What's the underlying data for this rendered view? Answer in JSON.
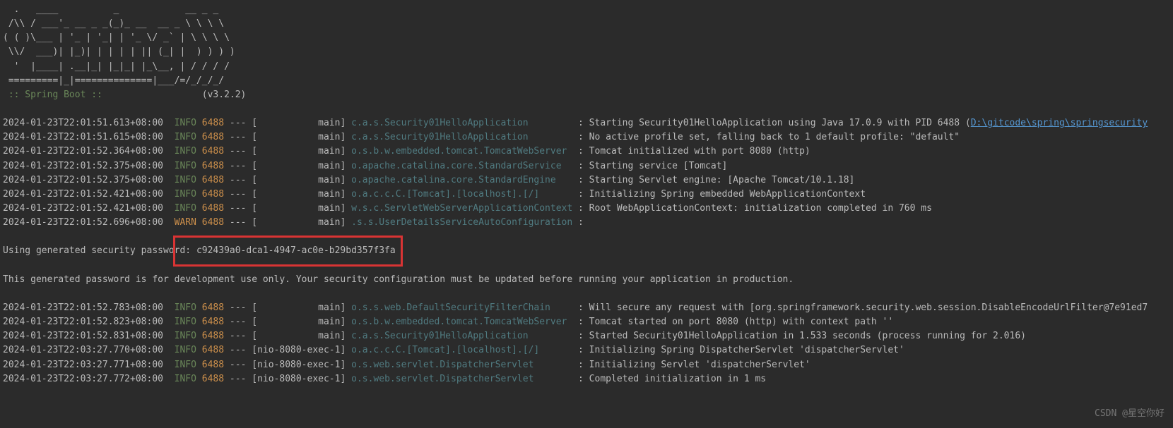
{
  "ascii": [
    "  .   ____          _            __ _ _",
    " /\\\\ / ___'_ __ _ _(_)_ __  __ _ \\ \\ \\ \\",
    "( ( )\\___ | '_ | '_| | '_ \\/ _` | \\ \\ \\ \\",
    " \\\\/  ___)| |_)| | | | | || (_| |  ) ) ) )",
    "  '  |____| .__|_| |_|_| |_\\__, | / / / /",
    " =========|_|==============|___/=/_/_/_/"
  ],
  "banner": {
    "label": " :: Spring Boot ::",
    "version": "(v3.2.2)"
  },
  "logs1": [
    {
      "ts": "2024-01-23T22:01:51.613+08:00",
      "lvl": "INFO",
      "pid": "6488",
      "sep": "--- [",
      "thread": "main",
      "br": "] ",
      "logger": "c.a.s.Security01HelloApplication",
      "msg": ": Starting Security01HelloApplication using Java 17.0.9 with PID 6488 (",
      "link": "D:\\gitcode\\spring\\springsecurity"
    },
    {
      "ts": "2024-01-23T22:01:51.615+08:00",
      "lvl": "INFO",
      "pid": "6488",
      "sep": "--- [",
      "thread": "main",
      "br": "] ",
      "logger": "c.a.s.Security01HelloApplication",
      "msg": ": No active profile set, falling back to 1 default profile: \"default\""
    },
    {
      "ts": "2024-01-23T22:01:52.364+08:00",
      "lvl": "INFO",
      "pid": "6488",
      "sep": "--- [",
      "thread": "main",
      "br": "] ",
      "logger": "o.s.b.w.embedded.tomcat.TomcatWebServer",
      "msg": ": Tomcat initialized with port 8080 (http)"
    },
    {
      "ts": "2024-01-23T22:01:52.375+08:00",
      "lvl": "INFO",
      "pid": "6488",
      "sep": "--- [",
      "thread": "main",
      "br": "] ",
      "logger": "o.apache.catalina.core.StandardService",
      "msg": ": Starting service [Tomcat]"
    },
    {
      "ts": "2024-01-23T22:01:52.375+08:00",
      "lvl": "INFO",
      "pid": "6488",
      "sep": "--- [",
      "thread": "main",
      "br": "] ",
      "logger": "o.apache.catalina.core.StandardEngine",
      "msg": ": Starting Servlet engine: [Apache Tomcat/10.1.18]"
    },
    {
      "ts": "2024-01-23T22:01:52.421+08:00",
      "lvl": "INFO",
      "pid": "6488",
      "sep": "--- [",
      "thread": "main",
      "br": "] ",
      "logger": "o.a.c.c.C.[Tomcat].[localhost].[/]",
      "msg": ": Initializing Spring embedded WebApplicationContext"
    },
    {
      "ts": "2024-01-23T22:01:52.421+08:00",
      "lvl": "INFO",
      "pid": "6488",
      "sep": "--- [",
      "thread": "main",
      "br": "] ",
      "logger": "w.s.c.ServletWebServerApplicationContext",
      "msg": ": Root WebApplicationContext: initialization completed in 760 ms"
    },
    {
      "ts": "2024-01-23T22:01:52.696+08:00",
      "lvl": "WARN",
      "pid": "6488",
      "sep": "--- [",
      "thread": "main",
      "br": "] ",
      "logger": ".s.s.UserDetailsServiceAutoConfiguration",
      "msg": ": "
    }
  ],
  "password": {
    "label": "Using generated security password: ",
    "value": "c92439a0-dca1-4947-ac0e-b29bd357f3fa"
  },
  "note": "This generated password is for development use only. Your security configuration must be updated before running your application in production.",
  "logs2": [
    {
      "ts": "2024-01-23T22:01:52.783+08:00",
      "lvl": "INFO",
      "pid": "6488",
      "sep": "--- [",
      "thread": "main",
      "br": "] ",
      "logger": "o.s.s.web.DefaultSecurityFilterChain",
      "msg": ": Will secure any request with [org.springframework.security.web.session.DisableEncodeUrlFilter@7e91ed7"
    },
    {
      "ts": "2024-01-23T22:01:52.823+08:00",
      "lvl": "INFO",
      "pid": "6488",
      "sep": "--- [",
      "thread": "main",
      "br": "] ",
      "logger": "o.s.b.w.embedded.tomcat.TomcatWebServer",
      "msg": ": Tomcat started on port 8080 (http) with context path ''"
    },
    {
      "ts": "2024-01-23T22:01:52.831+08:00",
      "lvl": "INFO",
      "pid": "6488",
      "sep": "--- [",
      "thread": "main",
      "br": "] ",
      "logger": "c.a.s.Security01HelloApplication",
      "msg": ": Started Security01HelloApplication in 1.533 seconds (process running for 2.016)"
    },
    {
      "ts": "2024-01-23T22:03:27.770+08:00",
      "lvl": "INFO",
      "pid": "6488",
      "sep": "--- [",
      "thread": "nio-8080-exec-1",
      "br": "] ",
      "logger": "o.a.c.c.C.[Tomcat].[localhost].[/]",
      "msg": ": Initializing Spring DispatcherServlet 'dispatcherServlet'"
    },
    {
      "ts": "2024-01-23T22:03:27.771+08:00",
      "lvl": "INFO",
      "pid": "6488",
      "sep": "--- [",
      "thread": "nio-8080-exec-1",
      "br": "] ",
      "logger": "o.s.web.servlet.DispatcherServlet",
      "msg": ": Initializing Servlet 'dispatcherServlet'"
    },
    {
      "ts": "2024-01-23T22:03:27.772+08:00",
      "lvl": "INFO",
      "pid": "6488",
      "sep": "--- [",
      "thread": "nio-8080-exec-1",
      "br": "] ",
      "logger": "o.s.web.servlet.DispatcherServlet",
      "msg": ": Completed initialization in 1 ms"
    }
  ],
  "watermark": "CSDN @星空你好",
  "widths": {
    "thread": 15,
    "logger": 41
  }
}
